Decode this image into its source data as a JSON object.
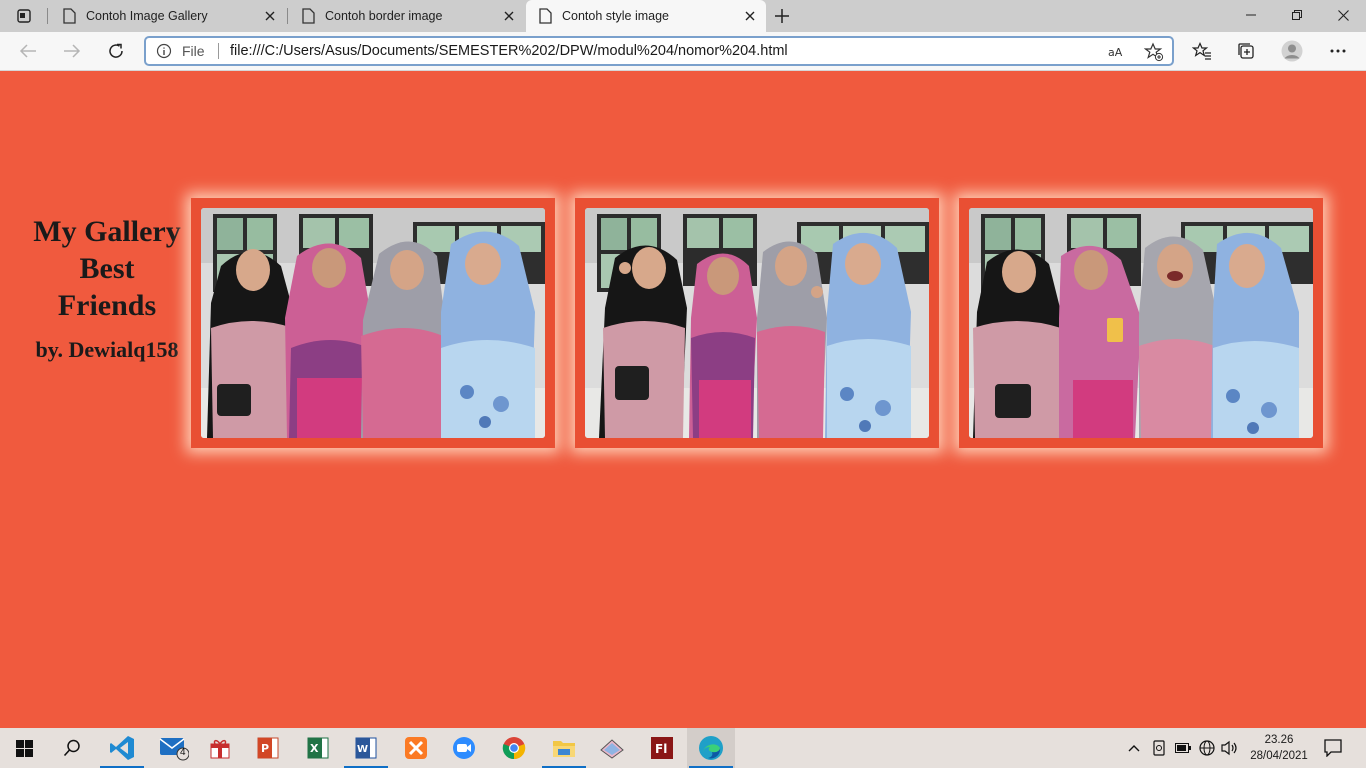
{
  "browser": {
    "tabs": [
      {
        "title": "Contoh Image Gallery"
      },
      {
        "title": "Contoh border image"
      },
      {
        "title": "Contoh style image"
      }
    ],
    "address": {
      "scheme_label": "File",
      "url": "file:///C:/Users/Asus/Documents/SEMESTER%202/DPW/modul%204/nomor%204.html"
    }
  },
  "page": {
    "background": "#f05a3e",
    "title": "My Gallery Best Friends",
    "author": "by. Dewialq158",
    "photos": [
      {
        "description": "four friends in hijabs standing arms crossed"
      },
      {
        "description": "four friends in hijabs doing OK hand gesture"
      },
      {
        "description": "four friends in hijabs laughing together"
      }
    ]
  },
  "taskbar": {
    "apps": [
      "windows-start",
      "search",
      "vscode",
      "mail",
      "gift-app",
      "powerpoint",
      "excel",
      "word",
      "xampp",
      "zoom",
      "chrome",
      "file-explorer",
      "paint",
      "flash",
      "edge"
    ],
    "mail_badge": "4",
    "clock_time": "23.26",
    "clock_date": "28/04/2021"
  }
}
